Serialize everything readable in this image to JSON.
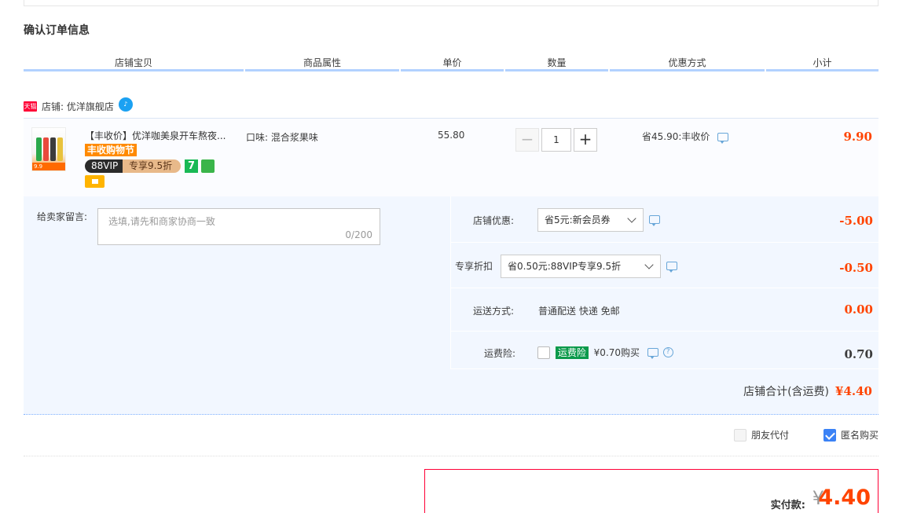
{
  "section_title": "确认订单信息",
  "columns": [
    "店铺宝贝",
    "商品属性",
    "单价",
    "数量",
    "优惠方式",
    "小计"
  ],
  "shop": {
    "badge": "天猫",
    "label": "店铺: 优洋旗舰店"
  },
  "item": {
    "title": "【丰收价】优洋咖美泉开车熬夜...",
    "promo_tag": "丰收购物节",
    "vip_label": "88VIP",
    "vip_offer": "专享9.5折",
    "seven_day_icon": "7",
    "thumb_tag": "9.9",
    "attribute": "口味: 混合浆果味",
    "unit_price": "55.80",
    "quantity": "1",
    "minus": "−",
    "plus": "+",
    "discount": "省45.90:丰收价",
    "subtotal": "9.90"
  },
  "message": {
    "label": "给卖家留言:",
    "placeholder": "选填,请先和商家协商一致",
    "counter": "0/200"
  },
  "shop_coupon": {
    "label": "店铺优惠:",
    "selected": "省5元:新会员券",
    "value": "-5.00"
  },
  "vip_discount": {
    "label": "专享折扣",
    "selected": "省0.50元:88VIP专享9.5折",
    "value": "-0.50"
  },
  "shipping": {
    "label": "运送方式:",
    "method": "普通配送 快递 免邮",
    "value": "0.00"
  },
  "insurance": {
    "label": "运费险:",
    "badge": "运费险",
    "price": "¥0.70购买",
    "help": "?",
    "value": "0.70"
  },
  "shop_total": {
    "label": "店铺合计(含运费)",
    "amount": "¥4.40"
  },
  "options": {
    "friend_pay": "朋友代付",
    "anonymous": "匿名购买"
  },
  "payment": {
    "label": "实付款:",
    "currency": "¥",
    "amount": "4.40"
  },
  "colors": {
    "accent_red": "#ff4400",
    "header_border": "#b2d1ff",
    "panel_bg": "#f2f7ff",
    "tmall_red": "#ff0036"
  }
}
